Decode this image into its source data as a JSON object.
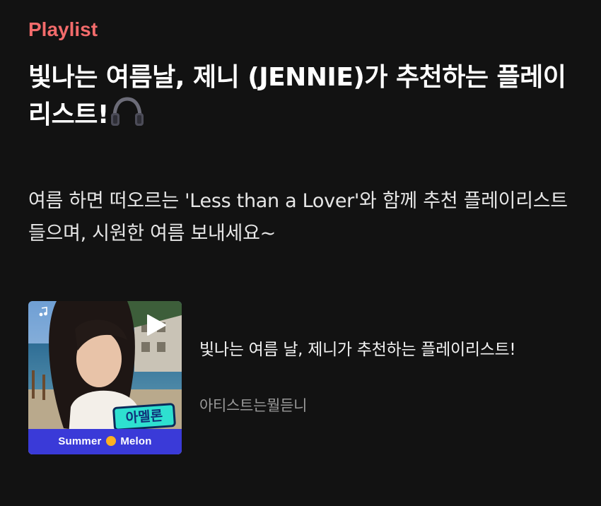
{
  "section_label": "Playlist",
  "headline": "빛나는 여름날, 제니 (JENNIE)가 추천하는 플레이리스트!",
  "description": "여름 하면 떠오르는 'Less than a Lover'와 함께 추천 플레이리스트 들으며, 시원한 여름 보내세요~",
  "playlist_card": {
    "title": "빛나는 여름 날, 제니가 추천하는 플레이리스트!",
    "subtitle": "아티스트는뭘듣니",
    "badge_text": "아멜론",
    "brand_left": "Summer",
    "brand_right": "Melon"
  },
  "colors": {
    "background": "#121212",
    "accent": "#f26b6b",
    "brand_bar": "#3a3ad8",
    "badge": "#2ee0d0"
  },
  "icons": {
    "headline_emoji": "headphones-icon",
    "play": "play-icon",
    "note": "music-note-icon"
  }
}
